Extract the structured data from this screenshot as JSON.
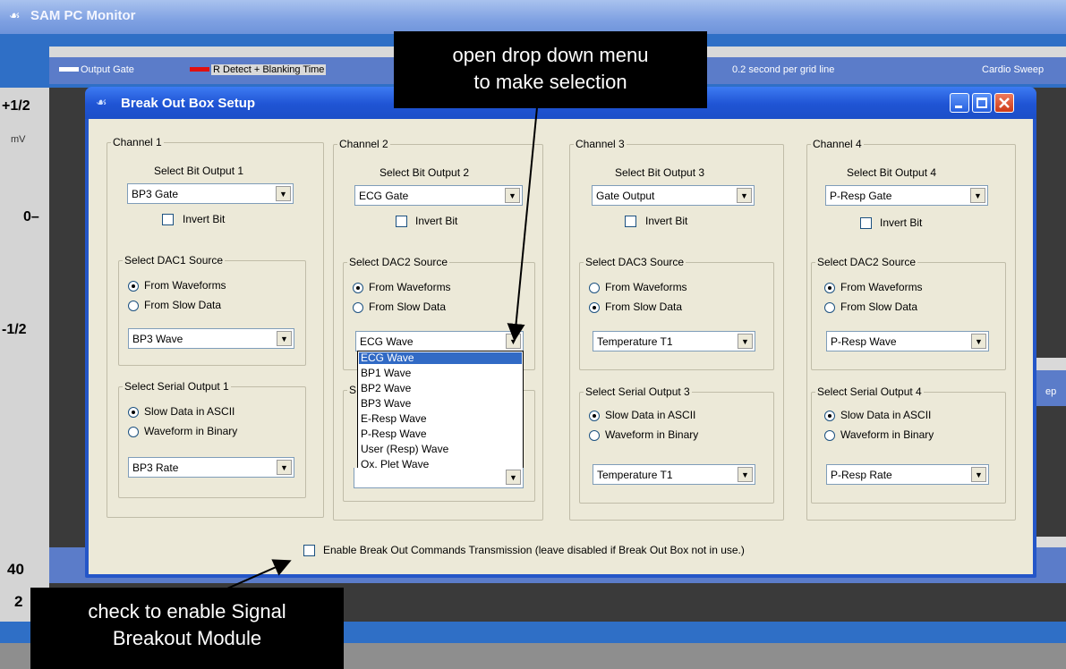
{
  "app": {
    "title": "SAM PC Monitor",
    "legend": {
      "output_gate": "Output Gate",
      "r_detect": "R Detect + Blanking Time",
      "grid_info": "0.2 second per grid line",
      "sweep": "Cardio Sweep",
      "sweep_partial": "ep"
    },
    "scale": {
      "plus_half": "+1/2",
      "unit": "mV",
      "zero": "0–",
      "minus_half": "-1/2",
      "forty": "40",
      "two": "2"
    }
  },
  "dialog": {
    "title": "Break Out Box Setup",
    "channels": [
      {
        "title": "Channel 1",
        "bit_label": "Select Bit Output 1",
        "bit_value": "BP3 Gate",
        "invert_label": "Invert Bit",
        "dac_title": "Select DAC1 Source",
        "dac_from_waveforms": "From Waveforms",
        "dac_from_slow": "From Slow Data",
        "dac_selected": "waveforms",
        "dac_value": "BP3 Wave",
        "serial_title": "Select Serial Output 1",
        "serial_ascii": "Slow Data in ASCII",
        "serial_binary": "Waveform in Binary",
        "serial_value": "BP3 Rate"
      },
      {
        "title": "Channel 2",
        "bit_label": "Select Bit Output 2",
        "bit_value": "ECG Gate",
        "invert_label": "Invert Bit",
        "dac_title": "Select DAC2 Source",
        "dac_from_waveforms": "From Waveforms",
        "dac_from_slow": "From Slow Data",
        "dac_selected": "waveforms",
        "dac_value": "ECG Wave",
        "serial_title_partial": "S"
      },
      {
        "title": "Channel 3",
        "bit_label": "Select Bit Output 3",
        "bit_value": "Gate Output",
        "invert_label": "Invert Bit",
        "dac_title": "Select DAC3 Source",
        "dac_from_waveforms": "From Waveforms",
        "dac_from_slow": "From Slow Data",
        "dac_selected": "slow",
        "dac_value": "Temperature T1",
        "serial_title": "Select Serial Output 3",
        "serial_ascii": "Slow Data in ASCII",
        "serial_binary": "Waveform in Binary",
        "serial_value": "Temperature T1"
      },
      {
        "title": "Channel 4",
        "bit_label": "Select Bit Output 4",
        "bit_value": "P-Resp Gate",
        "invert_label": "Invert Bit",
        "dac_title": "Select DAC2 Source",
        "dac_from_waveforms": "From Waveforms",
        "dac_from_slow": "From Slow Data",
        "dac_selected": "waveforms",
        "dac_value": "P-Resp Wave",
        "serial_title": "Select Serial Output 4",
        "serial_ascii": "Slow Data in ASCII",
        "serial_binary": "Waveform in Binary",
        "serial_value": "P-Resp Rate"
      }
    ],
    "dropdown_options": [
      "ECG Wave",
      "BP1 Wave",
      "BP2 Wave",
      "BP3 Wave",
      "E-Resp Wave",
      "P-Resp Wave",
      "User (Resp) Wave",
      "Ox. Plet Wave"
    ],
    "enable_label": "Enable Break Out Commands Transmission (leave disabled if Break Out Box not in use.)"
  },
  "callouts": {
    "dropdown_line1": "open drop down menu",
    "dropdown_line2": "to make selection",
    "enable_line1": "check to enable Signal",
    "enable_line2": "Breakout Module"
  },
  "colors": {
    "titlebar": "#2456c8",
    "dialog_bg": "#ece9d8",
    "selection": "#316ac5",
    "callout": "#000000"
  }
}
